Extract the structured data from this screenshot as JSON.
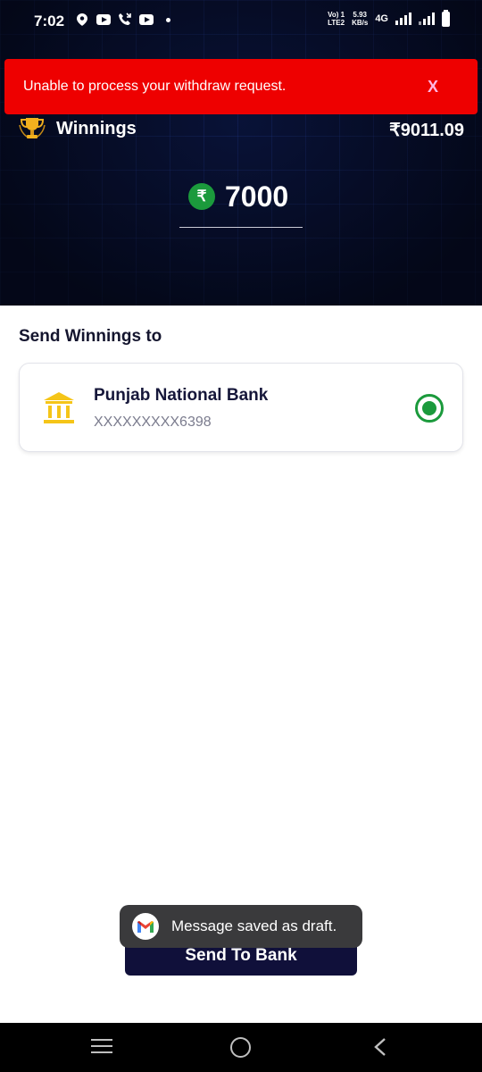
{
  "status_bar": {
    "time": "7:02",
    "volte_top": "Vo) 1",
    "volte_bottom": "LTE2",
    "speed_top": "5.93",
    "speed_bottom": "KB/s",
    "network": "4G"
  },
  "error_banner": {
    "message": "Unable to process your withdraw request.",
    "close_label": "X"
  },
  "winnings": {
    "label": "Winnings",
    "amount": "₹9011.09"
  },
  "withdraw": {
    "currency_symbol": "₹",
    "amount": "7000"
  },
  "send_section": {
    "title": "Send Winnings to",
    "bank_name": "Punjab National Bank",
    "account_number": "XXXXXXXXX6398",
    "selected": true
  },
  "send_button": {
    "label": "Send To Bank"
  },
  "toast": {
    "message": "Message saved as draft."
  },
  "colors": {
    "error_red": "#ee0000",
    "accent_green": "#1b9a3c",
    "button_navy": "#10103a",
    "header_dark": "#050b22"
  }
}
